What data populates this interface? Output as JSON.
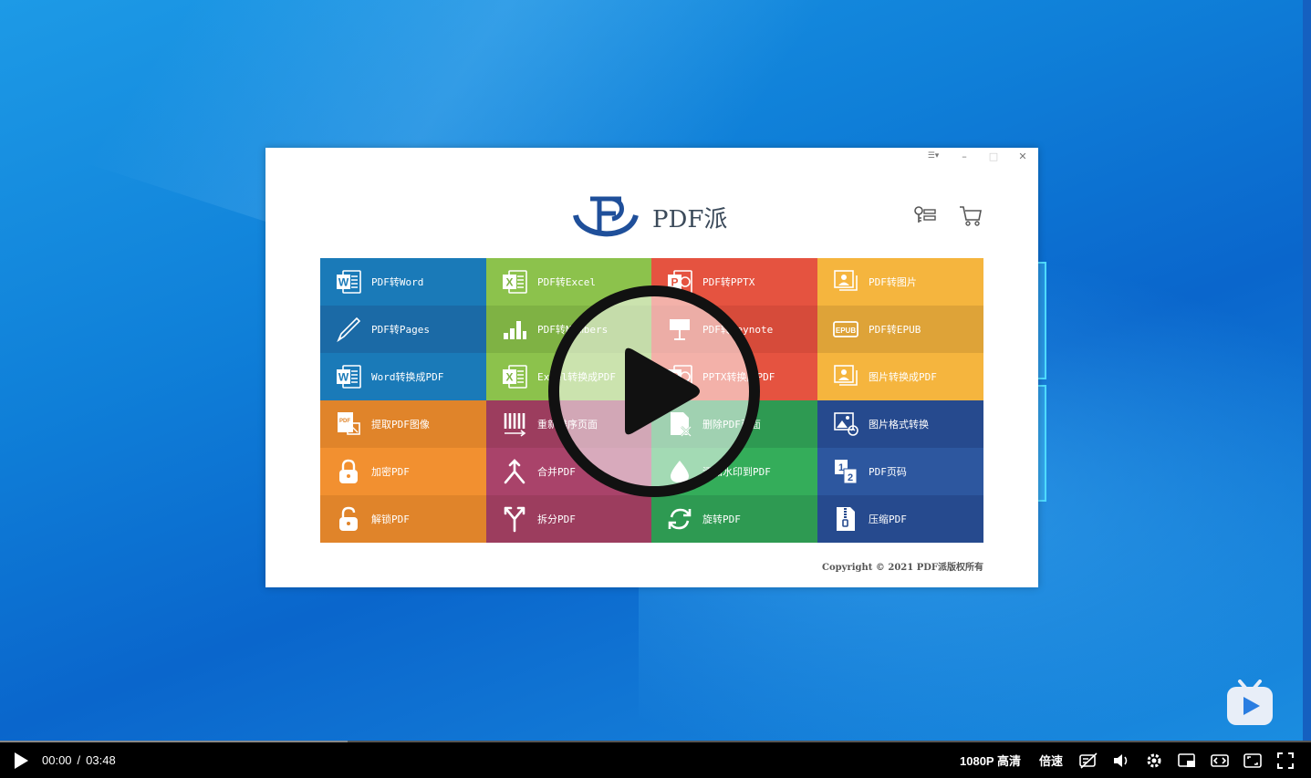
{
  "window": {
    "app_name": "PDF派",
    "controls": {
      "menu": "☰▾",
      "minimize": "–",
      "maximize": "□",
      "close": "✕"
    }
  },
  "header_icons": [
    "key-list-icon",
    "cart-icon"
  ],
  "tiles": [
    {
      "label": "PDF转Word",
      "icon": "word-icon",
      "color": "#1a7ab8"
    },
    {
      "label": "PDF转Excel",
      "icon": "excel-icon",
      "color": "#8cc24c"
    },
    {
      "label": "PDF转PPTX",
      "icon": "ppt-icon",
      "color": "#e55340"
    },
    {
      "label": "PDF转图片",
      "icon": "image-icon",
      "color": "#f5b53e"
    },
    {
      "label": "PDF转Pages",
      "icon": "pen-icon",
      "color": "#1b6aa6"
    },
    {
      "label": "PDF转Numbers",
      "icon": "bar-chart-icon",
      "color": "#7fb244"
    },
    {
      "label": "PDF转Keynote",
      "icon": "keynote-icon",
      "color": "#d64b3a"
    },
    {
      "label": "PDF转EPUB",
      "icon": "epub-icon",
      "color": "#dea338"
    },
    {
      "label": "Word转换成PDF",
      "icon": "word-icon",
      "color": "#1a7ab8"
    },
    {
      "label": "Excel转换成PDF",
      "icon": "excel-icon",
      "color": "#8cc24c"
    },
    {
      "label": "PPTX转换成PDF",
      "icon": "ppt-icon",
      "color": "#e55340"
    },
    {
      "label": "图片转换成PDF",
      "icon": "image-icon",
      "color": "#f5b53e"
    },
    {
      "label": "提取PDF图像",
      "icon": "extract-image-icon",
      "color": "#e0842a"
    },
    {
      "label": "重新排序页面",
      "icon": "reorder-icon",
      "color": "#9c3d5e"
    },
    {
      "label": "删除PDF页面",
      "icon": "delete-page-icon",
      "color": "#2e9a52"
    },
    {
      "label": "图片格式转换",
      "icon": "image-convert-icon",
      "color": "#264a8e"
    },
    {
      "label": "加密PDF",
      "icon": "lock-icon",
      "color": "#f29030"
    },
    {
      "label": "合并PDF",
      "icon": "merge-icon",
      "color": "#a9436a"
    },
    {
      "label": "添加水印到PDF",
      "icon": "watermark-icon",
      "color": "#34ad5a"
    },
    {
      "label": "PDF页码",
      "icon": "page-number-icon",
      "color": "#2d579f"
    },
    {
      "label": "解锁PDF",
      "icon": "unlock-icon",
      "color": "#e0842a"
    },
    {
      "label": "拆分PDF",
      "icon": "split-icon",
      "color": "#9c3d5e"
    },
    {
      "label": "旋转PDF",
      "icon": "rotate-icon",
      "color": "#2e9a52"
    },
    {
      "label": "压缩PDF",
      "icon": "zip-icon",
      "color": "#264a8e"
    }
  ],
  "copyright": "Copyright © 2021 PDF派版权所有",
  "player": {
    "current_time": "00:00",
    "separator": "/",
    "duration": "03:48",
    "quality": "1080P 高清",
    "speed": "倍速",
    "buffered_fraction": 0.265,
    "icons": [
      "danmaku-off-icon",
      "volume-icon",
      "settings-icon",
      "pip-icon",
      "widescreen-icon",
      "web-fullscreen-icon",
      "fullscreen-icon"
    ]
  }
}
